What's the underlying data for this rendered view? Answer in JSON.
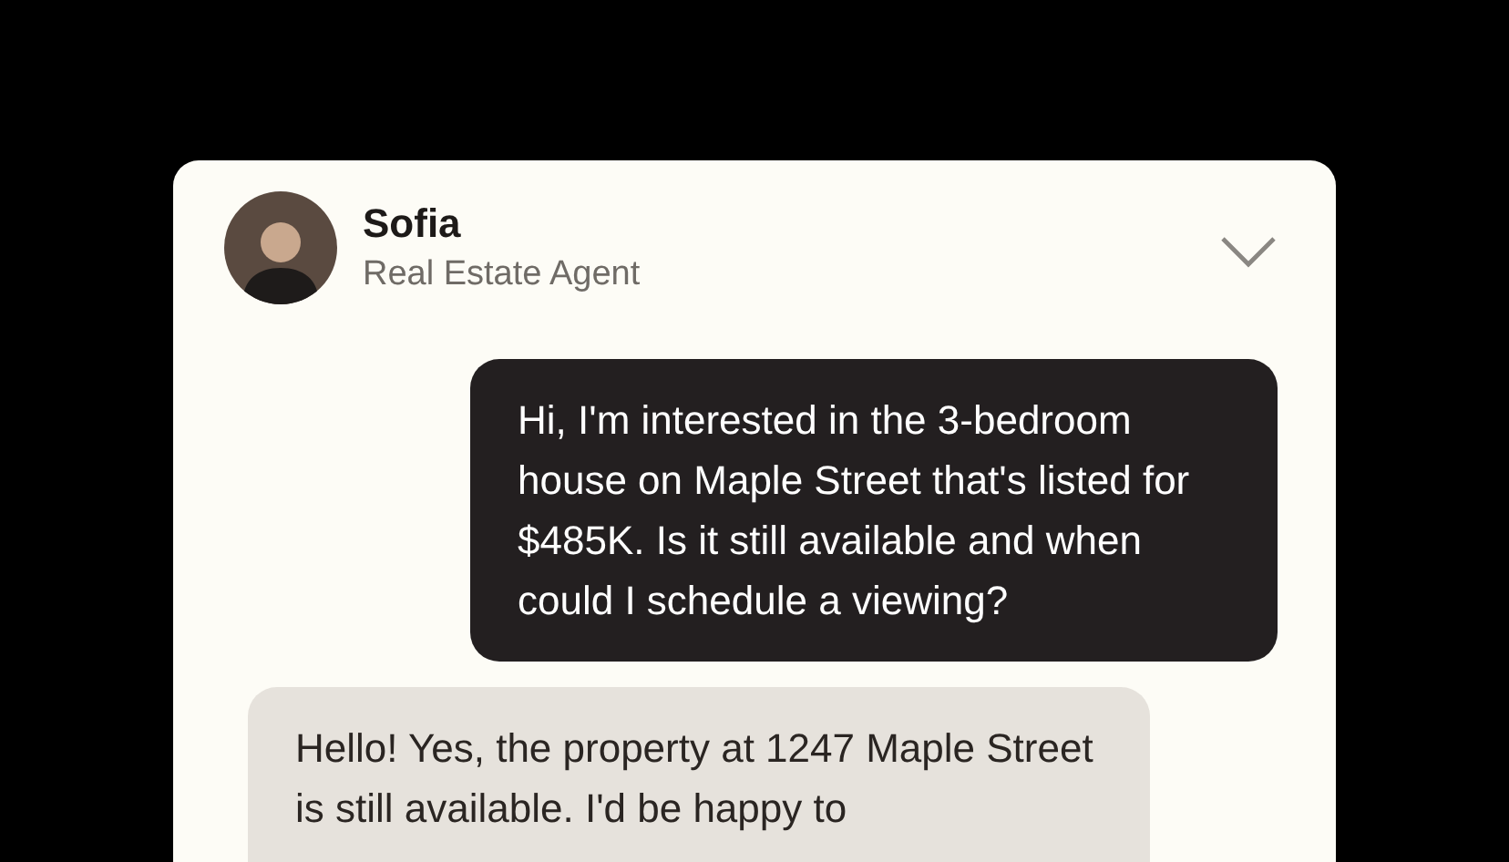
{
  "chat_header": {
    "name": "Sofia",
    "role": "Real Estate Agent",
    "expanded": false
  },
  "messages": [
    {
      "kind": "user",
      "text": "Hi, I'm interested in the 3-bedroom house on Maple Street that's listed for $485K. Is it still available and when could I schedule a viewing?"
    },
    {
      "kind": "agent",
      "text": "Hello! Yes, the property at 1247 Maple Street is still available. I'd be happy to"
    }
  ]
}
